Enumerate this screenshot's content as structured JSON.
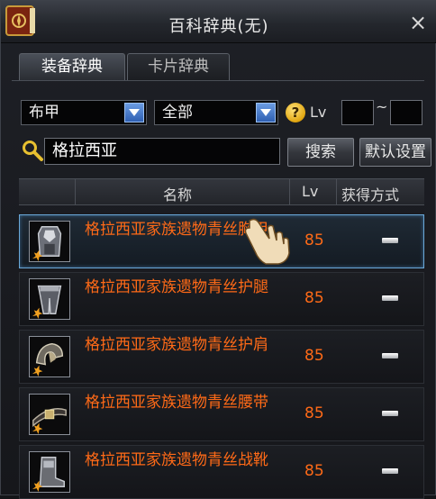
{
  "window": {
    "title": "百科辞典(无)",
    "close_label": "×"
  },
  "tabs": [
    {
      "label": "装备辞典",
      "active": true
    },
    {
      "label": "卡片辞典",
      "active": false
    }
  ],
  "filters": {
    "armor_type": "布甲",
    "category": "全部",
    "help_label": "?",
    "lv_label": "Lv",
    "lv_min": "",
    "lv_max": "",
    "range_separator": "~"
  },
  "search": {
    "value": "格拉西亚",
    "search_label": "搜索",
    "default_label": "默认设置"
  },
  "table": {
    "headers": {
      "name": "名称",
      "lv": "Lv",
      "source": "获得方式"
    },
    "rows": [
      {
        "name": "格拉西亚家族遗物青丝胸甲",
        "lv": "85",
        "icon": "chest-armor-icon",
        "source_icon": "dash-icon",
        "selected": true
      },
      {
        "name": "格拉西亚家族遗物青丝护腿",
        "lv": "85",
        "icon": "leg-armor-icon",
        "source_icon": "dash-icon",
        "selected": false
      },
      {
        "name": "格拉西亚家族遗物青丝护肩",
        "lv": "85",
        "icon": "shoulder-armor-icon",
        "source_icon": "dash-icon",
        "selected": false
      },
      {
        "name": "格拉西亚家族遗物青丝腰带",
        "lv": "85",
        "icon": "belt-icon",
        "source_icon": "dash-icon",
        "selected": false
      },
      {
        "name": "格拉西亚家族遗物青丝战靴",
        "lv": "85",
        "icon": "boots-icon",
        "source_icon": "dash-icon",
        "selected": false
      }
    ]
  },
  "colors": {
    "item_name": "#ff6a17",
    "selected_border": "#6aa8d8",
    "dropdown_arrow": "#2e5fb2"
  }
}
